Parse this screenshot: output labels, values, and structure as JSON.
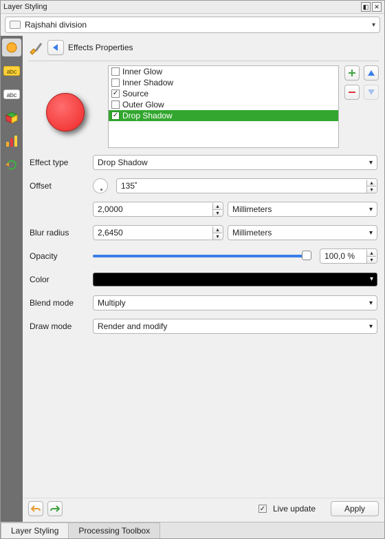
{
  "titlebar": {
    "title": "Layer Styling"
  },
  "layer": {
    "name": "Rajshahi division"
  },
  "effects_header": {
    "title": "Effects Properties"
  },
  "effects_list": [
    {
      "label": "Inner Glow",
      "checked": false,
      "selected": false
    },
    {
      "label": "Inner Shadow",
      "checked": false,
      "selected": false
    },
    {
      "label": "Source",
      "checked": true,
      "selected": false
    },
    {
      "label": "Outer Glow",
      "checked": false,
      "selected": false
    },
    {
      "label": "Drop Shadow",
      "checked": true,
      "selected": true
    }
  ],
  "effect_type": {
    "label": "Effect type",
    "value": "Drop Shadow"
  },
  "offset": {
    "label": "Offset",
    "angle": "135˚",
    "distance": "2,0000",
    "unit": "Millimeters"
  },
  "blur": {
    "label": "Blur radius",
    "value": "2,6450",
    "unit": "Millimeters"
  },
  "opacity": {
    "label": "Opacity",
    "value": "100,0 %"
  },
  "color": {
    "label": "Color",
    "hex": "#000000"
  },
  "blend_mode": {
    "label": "Blend mode",
    "value": "Multiply"
  },
  "draw_mode": {
    "label": "Draw mode",
    "value": "Render and modify"
  },
  "footer": {
    "live_update_label": "Live update",
    "live_update_checked": true,
    "apply_label": "Apply"
  },
  "bottom_tabs": [
    {
      "label": "Layer Styling",
      "active": true
    },
    {
      "label": "Processing Toolbox",
      "active": false
    }
  ],
  "side_icons": [
    "single-symbol-icon",
    "labels-abc-yellow-icon",
    "labels-abc-white-icon",
    "3d-cube-icon",
    "diagram-icon",
    "refresh-history-icon"
  ]
}
